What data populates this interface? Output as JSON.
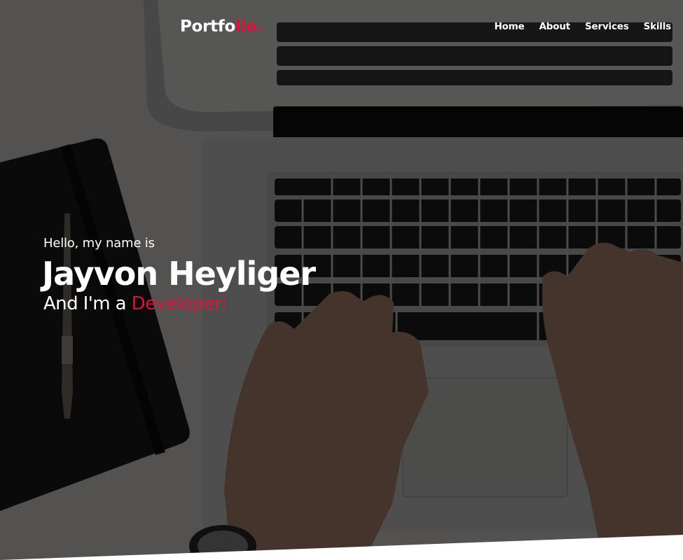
{
  "navbar": {
    "logo_main": "Portfo",
    "logo_accent": "lio.",
    "items": [
      {
        "label": "Home"
      },
      {
        "label": "About"
      },
      {
        "label": "Services"
      },
      {
        "label": "Skills"
      }
    ]
  },
  "hero": {
    "greeting": "Hello, my name is",
    "name": "Jayvon Heyliger",
    "role_prefix": "And I'm a",
    "role": "Developer"
  },
  "colors": {
    "accent": "#dc143c",
    "text": "#ffffff",
    "overlay": "#000000"
  }
}
